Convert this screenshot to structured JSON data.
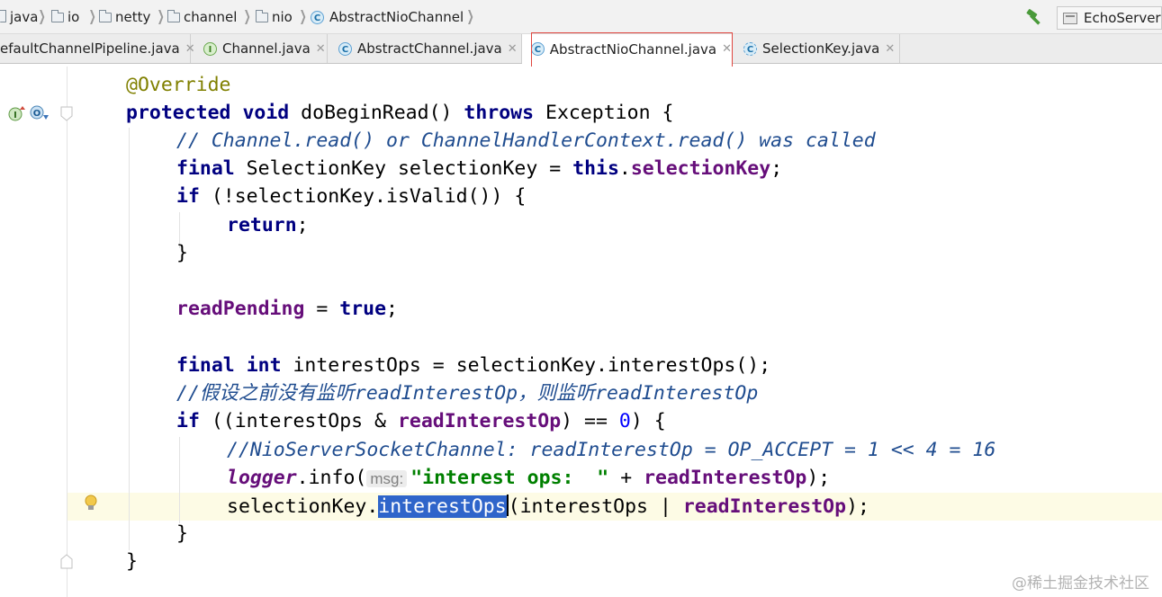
{
  "breadcrumb": [
    "java",
    "io",
    "netty",
    "channel",
    "nio",
    "AbstractNioChannel"
  ],
  "run_config": {
    "label": "EchoServer"
  },
  "tabs": [
    {
      "label": "efaultChannelPipeline.java",
      "icon": "class-icon"
    },
    {
      "label": "Channel.java",
      "icon": "interface-icon"
    },
    {
      "label": "AbstractChannel.java",
      "icon": "class-icon"
    },
    {
      "label": "AbstractNioChannel.java",
      "icon": "class-icon",
      "active": true
    },
    {
      "label": "SelectionKey.java",
      "icon": "abstract-class-icon"
    }
  ],
  "code": {
    "l1": {
      "ann": "@Override"
    },
    "l2": {
      "kw1": "protected",
      "kw2": "void",
      "t1": " doBeginRead() ",
      "kw3": "throws",
      "t2": " Exception {"
    },
    "l3": {
      "comment": "// Channel.read() or ChannelHandlerContext.read() was called"
    },
    "l4": {
      "kw1": "final",
      "t1": " SelectionKey selectionKey = ",
      "kw2": "this",
      "t2": ".",
      "f1": "selectionKey",
      "t3": ";"
    },
    "l5": {
      "kw1": "if",
      "t1": " (!selectionKey.isValid()) {"
    },
    "l6": {
      "kw1": "return",
      "t1": ";"
    },
    "l7": {
      "t1": "}"
    },
    "l8": {
      "f1": "readPending",
      "t1": " = ",
      "kw1": "true",
      "t2": ";"
    },
    "l9": {
      "kw1": "final",
      "kw2": "int",
      "t1": " interestOps = selectionKey.interestOps();"
    },
    "l10": {
      "comment": "//假设之前没有监听readInterestOp，则监听readInterestOp"
    },
    "l11": {
      "kw1": "if",
      "t1": " ((interestOps & ",
      "f1": "readInterestOp",
      "t2": ") == ",
      "num": "0",
      "t3": ") {"
    },
    "l12": {
      "comment": "//NioServerSocketChannel: readInterestOp = OP_ACCEPT = 1 << 4 = 16"
    },
    "l13": {
      "f1": "logger",
      "t1": ".info(",
      "hint": "msg:",
      "str": "\"interest ops:  \"",
      "t2": " + ",
      "f2": "readInterestOp",
      "t3": ");"
    },
    "l14": {
      "t1": "selectionKey.",
      "sel": "interestOps",
      "t2": "(interestOps | ",
      "f1": "readInterestOp",
      "t3": ");"
    },
    "l15": {
      "t1": "}"
    },
    "l16": {
      "t1": "}"
    }
  },
  "watermark": "@稀土掘金技术社区"
}
